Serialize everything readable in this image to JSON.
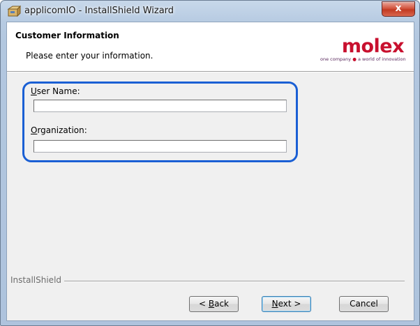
{
  "window": {
    "title": "applicomIO - InstallShield Wizard",
    "close_label": "x",
    "app_icon": "installshield-box-icon"
  },
  "header": {
    "title": "Customer Information",
    "subtitle": "Please enter your information.",
    "logo": {
      "word": "molex",
      "tagline_a": "one company",
      "tagline_b": "a world of innovation"
    }
  },
  "form": {
    "user_name": {
      "label_accel": "U",
      "label_rest": "ser Name:",
      "value": ""
    },
    "organization": {
      "label_accel": "O",
      "label_rest": "rganization:",
      "value": ""
    }
  },
  "footer": {
    "brand": "InstallShield"
  },
  "buttons": {
    "back_pre": "< ",
    "back_accel": "B",
    "back_rest": "ack",
    "next_accel": "N",
    "next_rest": "ext >",
    "cancel": "Cancel"
  },
  "colors": {
    "highlight": "#1a5fd4",
    "logo_red": "#c8102e"
  }
}
